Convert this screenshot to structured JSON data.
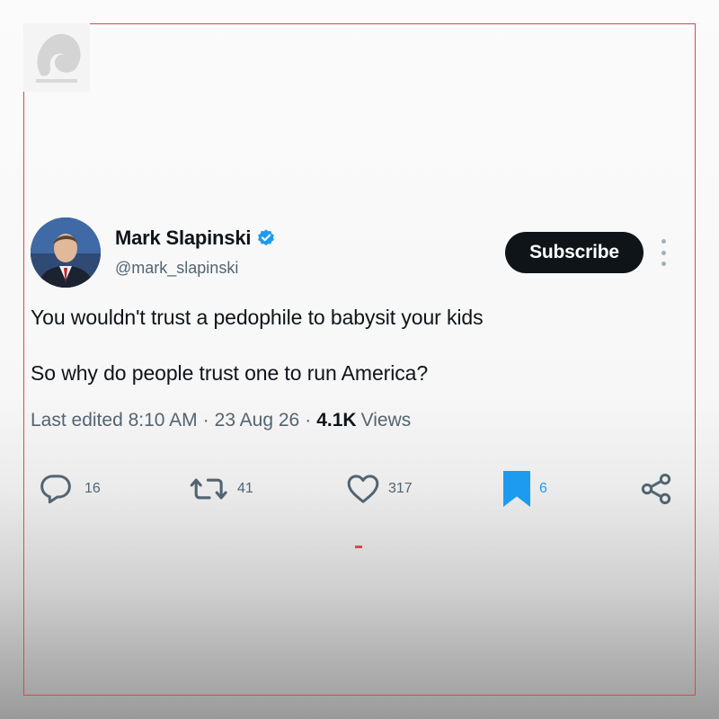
{
  "colors": {
    "frame_border": "#e2454a",
    "subscribe_bg": "#0f1419",
    "verified_badge": "#1d9bf0",
    "bookmark_active": "#1d9bf0",
    "secondary_text": "#536471"
  },
  "logo": {
    "icon": "brand-logo-icon"
  },
  "tweet": {
    "author": {
      "name": "Mark Slapinski",
      "handle": "@mark_slapinski",
      "verified_icon": "verified-badge-icon"
    },
    "subscribe_label": "Subscribe",
    "more_icon": "more-vertical-icon",
    "text_line1": "You wouldn't trust a pedophile to babysit your kids",
    "text_line2": "So why do people trust one to run America?",
    "meta": {
      "edited": "Last edited 8:10 AM",
      "separator": "·",
      "date": "23 Aug 26",
      "views_count": "4.1K",
      "views_label": "Views"
    },
    "actions": {
      "reply": {
        "icon": "reply-icon",
        "count": "16"
      },
      "retweet": {
        "icon": "retweet-icon",
        "count": "41"
      },
      "like": {
        "icon": "heart-icon",
        "count": "317"
      },
      "bookmark": {
        "icon": "bookmark-icon",
        "count": "6"
      },
      "share": {
        "icon": "share-icon"
      }
    }
  }
}
